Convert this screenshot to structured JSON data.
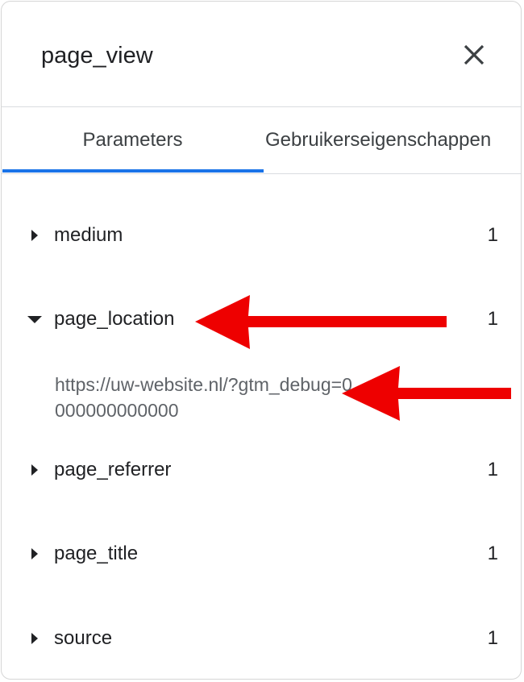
{
  "dialog": {
    "title": "page_view",
    "close_icon": "close-icon"
  },
  "tabs": [
    {
      "label": "Parameters",
      "active": true
    },
    {
      "label": "Gebruikerseigenschappen",
      "active": false
    }
  ],
  "parameters": [
    {
      "name": "medium",
      "count": "1",
      "expanded": false
    },
    {
      "name": "page_location",
      "count": "1",
      "expanded": true,
      "value": "https://uw-website.nl/?gtm_debug=0000000000000"
    },
    {
      "name": "page_referrer",
      "count": "1",
      "expanded": false
    },
    {
      "name": "page_title",
      "count": "1",
      "expanded": false
    },
    {
      "name": "source",
      "count": "1",
      "expanded": false
    }
  ],
  "colors": {
    "tab_indicator": "#1a73e8",
    "annotation_arrow": "#ee0000"
  }
}
